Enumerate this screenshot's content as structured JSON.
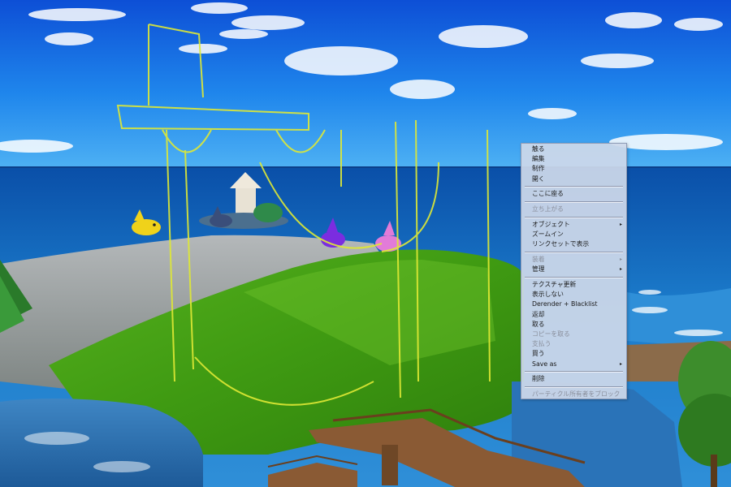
{
  "context_menu": {
    "groups": [
      [
        {
          "label": "触る",
          "enabled": true,
          "submenu": false
        },
        {
          "label": "編集",
          "enabled": true,
          "submenu": false
        },
        {
          "label": "制作",
          "enabled": true,
          "submenu": false
        },
        {
          "label": "開く",
          "enabled": true,
          "submenu": false
        }
      ],
      [
        {
          "label": "ここに座る",
          "enabled": true,
          "submenu": false
        }
      ],
      [
        {
          "label": "立ち上がる",
          "enabled": false,
          "submenu": false
        }
      ],
      [
        {
          "label": "オブジェクト",
          "enabled": true,
          "submenu": true
        },
        {
          "label": "ズームイン",
          "enabled": true,
          "submenu": false
        },
        {
          "label": "リンクセットで表示",
          "enabled": true,
          "submenu": false
        }
      ],
      [
        {
          "label": "装着",
          "enabled": false,
          "submenu": true
        },
        {
          "label": "管理",
          "enabled": true,
          "submenu": true
        }
      ],
      [
        {
          "label": "テクスチャ更新",
          "enabled": true,
          "submenu": false
        },
        {
          "label": "表示しない",
          "enabled": true,
          "submenu": false
        },
        {
          "label": "Derender + Blacklist",
          "enabled": true,
          "submenu": false
        },
        {
          "label": "返却",
          "enabled": true,
          "submenu": false
        },
        {
          "label": "取る",
          "enabled": true,
          "submenu": false
        },
        {
          "label": "コピーを取る",
          "enabled": false,
          "submenu": false
        },
        {
          "label": "支払う",
          "enabled": false,
          "submenu": false
        },
        {
          "label": "買う",
          "enabled": true,
          "submenu": false
        },
        {
          "label": "Save as",
          "enabled": true,
          "submenu": true
        }
      ],
      [
        {
          "label": "削除",
          "enabled": true,
          "submenu": false
        }
      ],
      [
        {
          "label": "パーティクル所有者をブロック",
          "enabled": false,
          "submenu": false
        }
      ]
    ],
    "submenu_arrow": "▸"
  }
}
